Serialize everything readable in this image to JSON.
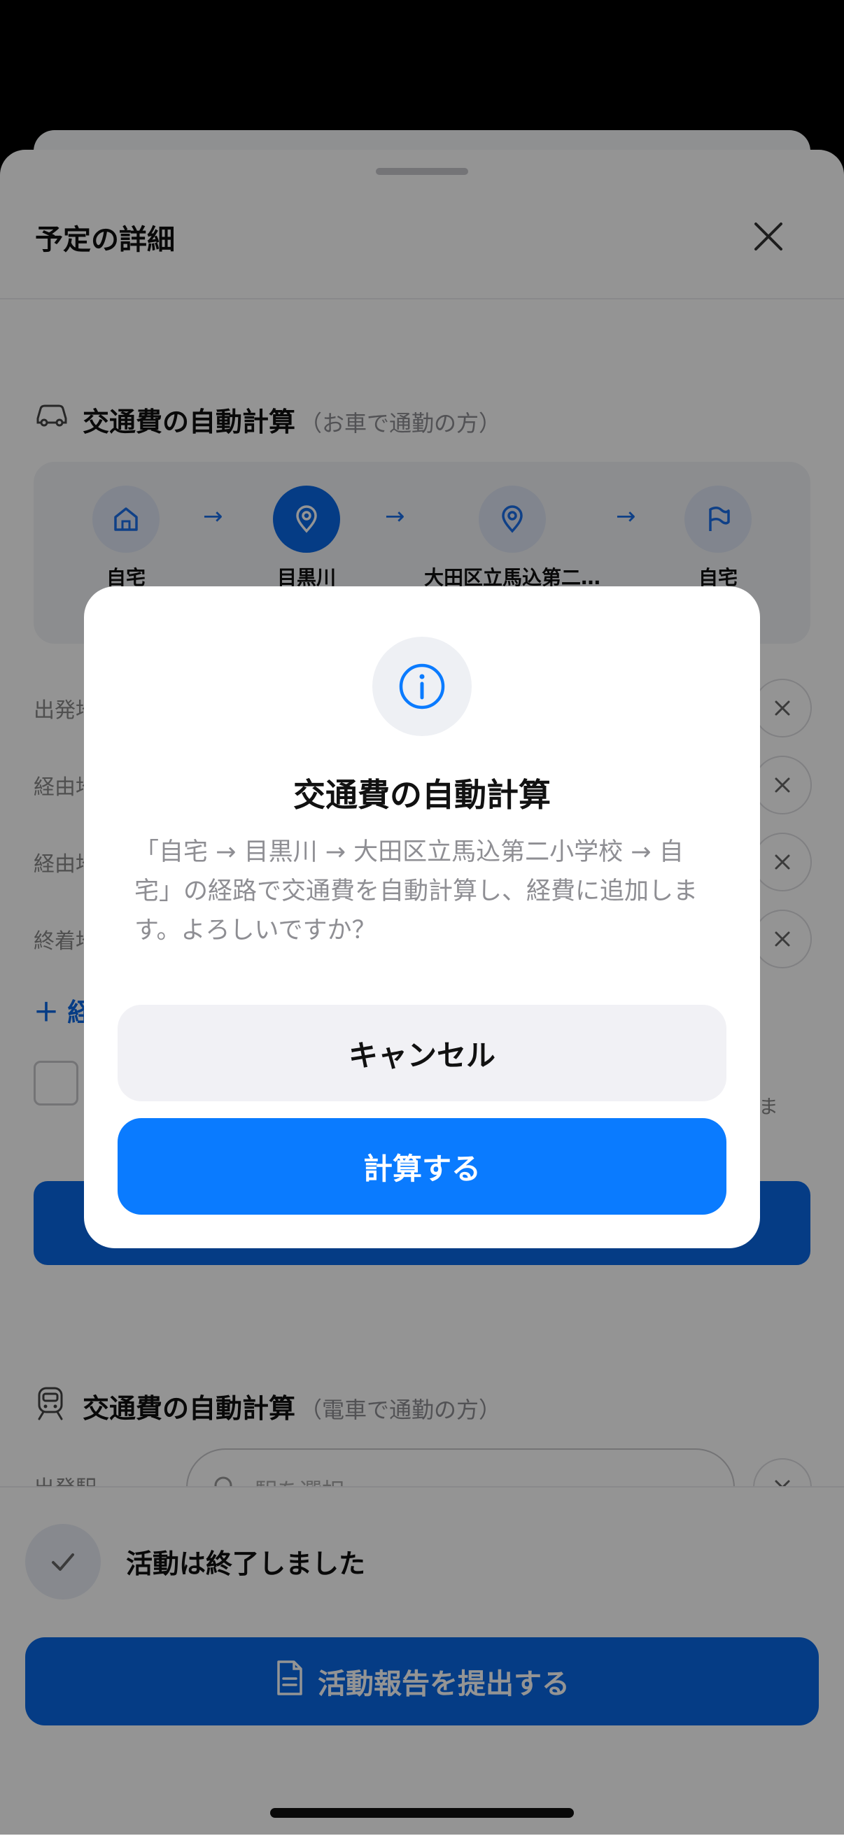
{
  "sheet": {
    "title": "予定の詳細"
  },
  "car_section": {
    "title": "交通費の自動計算",
    "subtitle": "（お車で通勤の方）",
    "stops": [
      {
        "label": "自宅",
        "icon": "home-icon"
      },
      {
        "label": "目黒川",
        "icon": "pin-icon"
      },
      {
        "label": "大田区立馬込第二…",
        "icon": "pin-icon"
      },
      {
        "label": "自宅",
        "icon": "flag-icon"
      }
    ],
    "field_labels": [
      "出発地",
      "経由地",
      "経由地",
      "終着地"
    ],
    "add_label": "＋ 経",
    "partial_text": "ま"
  },
  "train_section": {
    "title": "交通費の自動計算",
    "subtitle": "（電車で通勤の方）",
    "departure_label": "出発駅",
    "search_placeholder": "駅を選択"
  },
  "bottom": {
    "status_text": "活動は終了しました",
    "submit_label": "活動報告を提出する"
  },
  "modal": {
    "title": "交通費の自動計算",
    "body": "「自宅 → 目黒川 → 大田区立馬込第二小学校 → 自宅」の経路で交通費を自動計算し、経費に追加します。よろしいですか？",
    "cancel_label": "キャンセル",
    "confirm_label": "計算する"
  },
  "colors": {
    "primary": "#0a7bff",
    "primary_dark": "#0a68e6",
    "muted_text": "#8e8e93"
  }
}
